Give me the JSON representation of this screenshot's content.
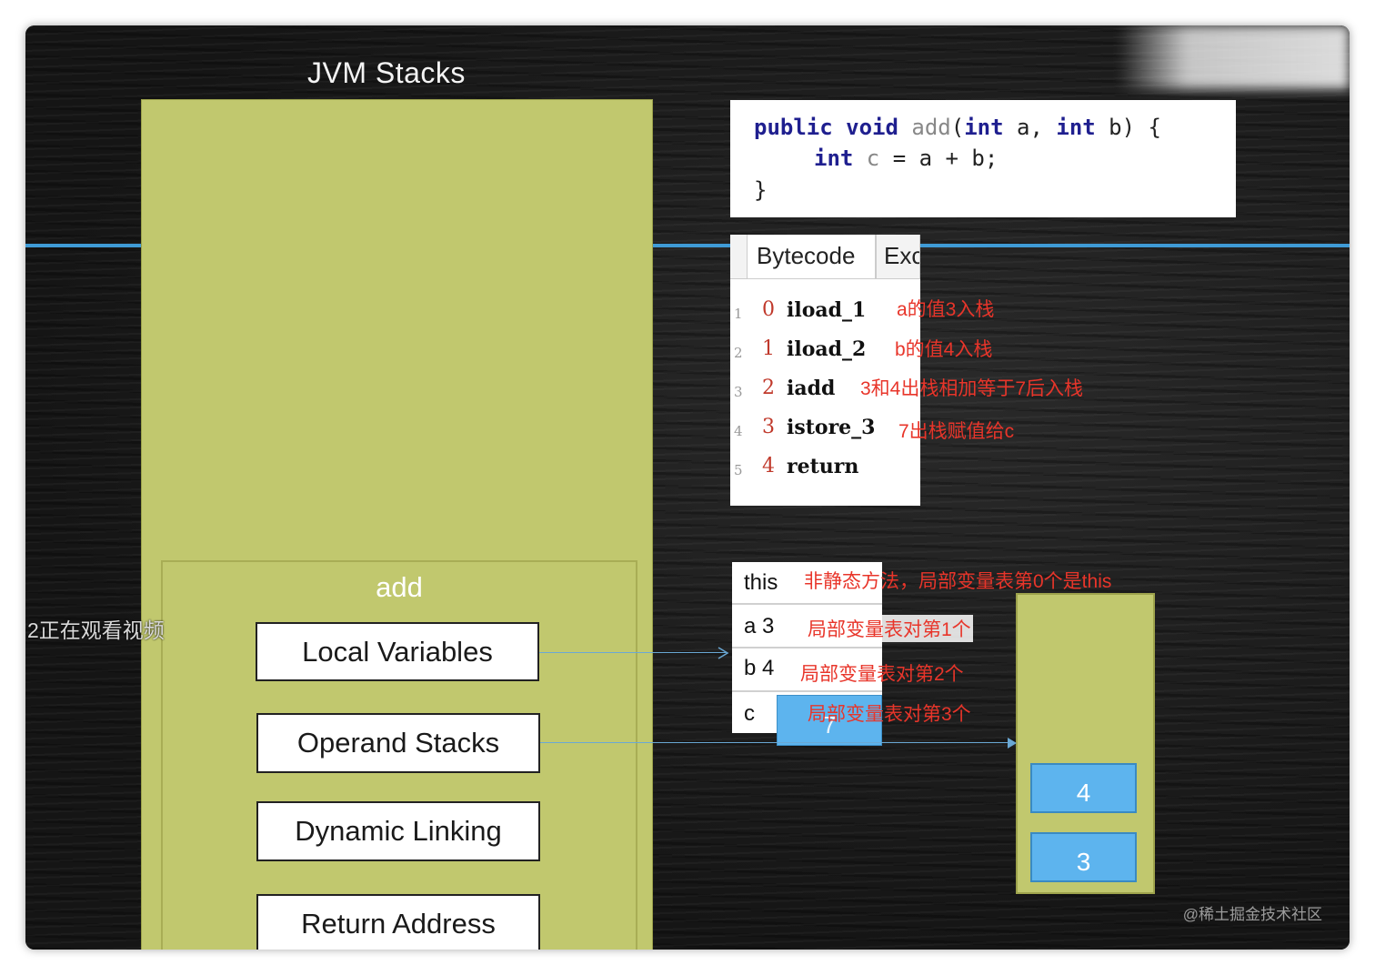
{
  "diagram": {
    "title": "JVM Stacks",
    "frame_label": "add",
    "frame_parts": [
      "Local Variables",
      "Operand Stacks",
      "Dynamic Linking",
      "Return Address"
    ]
  },
  "code": {
    "line1": {
      "kw1": "public",
      "kw2": "void",
      "fn": "add",
      "p1": "(",
      "kw3": "int",
      "p2": " a, ",
      "kw4": "int",
      "p3": " b) {"
    },
    "line2": {
      "kw": "int",
      "var": " c",
      "rest": " = a + b;"
    },
    "line3": "}"
  },
  "bytecode": {
    "tabs": [
      "Bytecode",
      "Exc"
    ],
    "rows": [
      {
        "line": "1",
        "offset": "0",
        "instr": "iload_1",
        "note": "a的值3入栈"
      },
      {
        "line": "2",
        "offset": "1",
        "instr": "iload_2",
        "note": "b的值4入栈"
      },
      {
        "line": "3",
        "offset": "2",
        "instr": "iadd",
        "note": "3和4出栈相加等于7后入栈"
      },
      {
        "line": "4",
        "offset": "3",
        "instr": "istore_3",
        "note": "7出栈赋值给c"
      },
      {
        "line": "5",
        "offset": "4",
        "instr": "return",
        "note": ""
      }
    ]
  },
  "local_variables": [
    {
      "label": "this",
      "note": "非静态方法，局部变量表第0个是this"
    },
    {
      "label": "a 3",
      "note": "局部变量表对第1个"
    },
    {
      "label": "b 4",
      "note": "局部变量表对第2个"
    },
    {
      "label": "c",
      "note": "局部变量表对第3个"
    }
  ],
  "c_value": "7",
  "operand_stack": [
    "4",
    "3"
  ],
  "overlay": {
    "viewer_text": "2正在观看视频",
    "watermark": "@稀土掘金技术社区"
  },
  "colors": {
    "board": "#1b1b1b",
    "stack_green": "#c1c86e",
    "value_blue": "#5db4ee",
    "annotation_red": "#e8352a",
    "divider_blue": "#3f9bd6"
  }
}
